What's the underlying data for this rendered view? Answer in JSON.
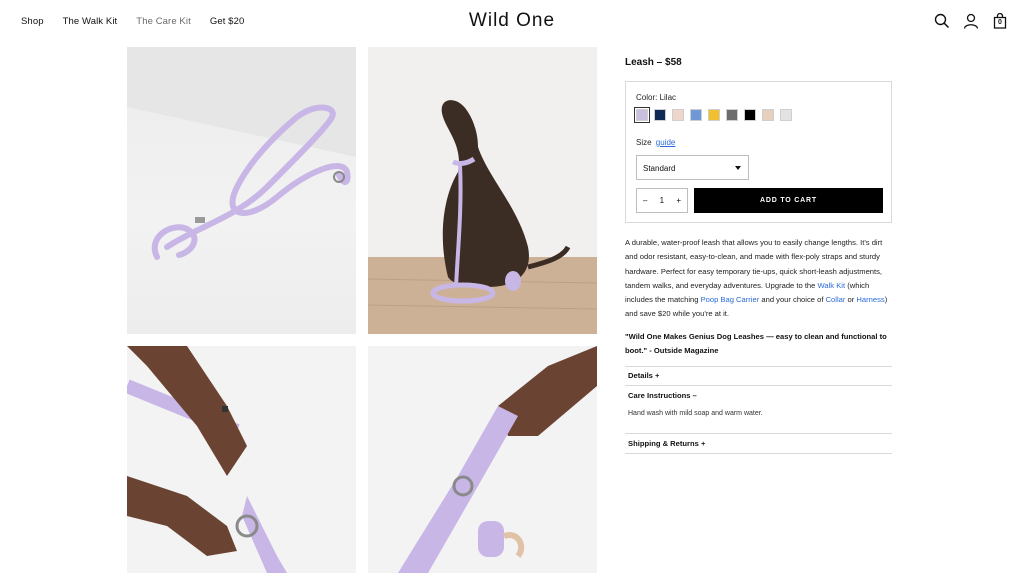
{
  "nav": {
    "items": [
      "Shop",
      "The Walk Kit",
      "The Care Kit",
      "Get $20"
    ]
  },
  "logo": "Wild One",
  "header_icons": [
    "search-icon",
    "account-icon",
    "cart-icon"
  ],
  "cart_count": "0",
  "product": {
    "title": "Leash – $58",
    "color_label": "Color: Lilac",
    "swatches": [
      "#cbbfe0",
      "#0f2a55",
      "#efd6cc",
      "#6e98d6",
      "#f2bf2e",
      "#6d6d6d",
      "#000000",
      "#e7cfbd",
      "#e3e3e3"
    ],
    "selected_swatch": 0,
    "size_label": "Size",
    "size_guide": "guide",
    "size_value": "Standard",
    "qty_minus": "–",
    "qty_value": "1",
    "qty_plus": "+",
    "add_to_cart": "ADD TO CART"
  },
  "description": {
    "p1": "A durable, water-proof leash that allows you to easily change lengths. It's dirt and odor resistant, easy-to-clean, and made with flex-poly straps and sturdy hardware. Perfect for easy temporary tie-ups, quick short-leash adjustments, tandem walks, and everyday adventures. Upgrade to the",
    "walk_kit": "Walk Kit",
    "p2": "(which includes the matching",
    "poop_bag": "Poop Bag Carrier",
    "p3": "and your choice of",
    "collar": "Collar",
    "p4": "or",
    "harness": "Harness",
    "p5": ") and save $20 while you're at it."
  },
  "quote": "\"Wild One Makes Genius Dog Leashes — easy to clean and functional to boot.\" - Outside Magazine",
  "accordion": {
    "details": "Details  +",
    "care": "Care Instructions  –",
    "care_body": "Hand wash with mild soap and warm water.",
    "shipping": "Shipping & Returns  +"
  },
  "colors": {
    "lilac": "#c8b6e6",
    "link": "#2b6bd9",
    "button": "#000000"
  }
}
